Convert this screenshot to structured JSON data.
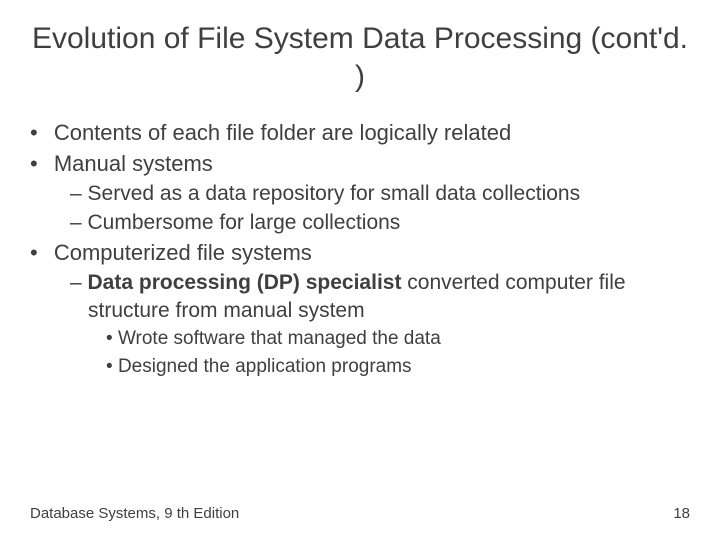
{
  "title": "Evolution of File System Data Processing (cont'd. )",
  "bullets": {
    "b1": "Contents of each file folder are logically related",
    "b2": "Manual systems",
    "b2_1": "Served as a data repository for small data collections",
    "b2_2": "Cumbersome for large collections",
    "b3": "Computerized file systems",
    "b3_1_bold": "Data processing (DP) specialist",
    "b3_1_rest": " converted computer file structure from manual system",
    "b3_1_1": "Wrote software that managed the data",
    "b3_1_2": "Designed the application programs"
  },
  "footer": {
    "left": "Database Systems, 9 th Edition",
    "right": "18"
  }
}
